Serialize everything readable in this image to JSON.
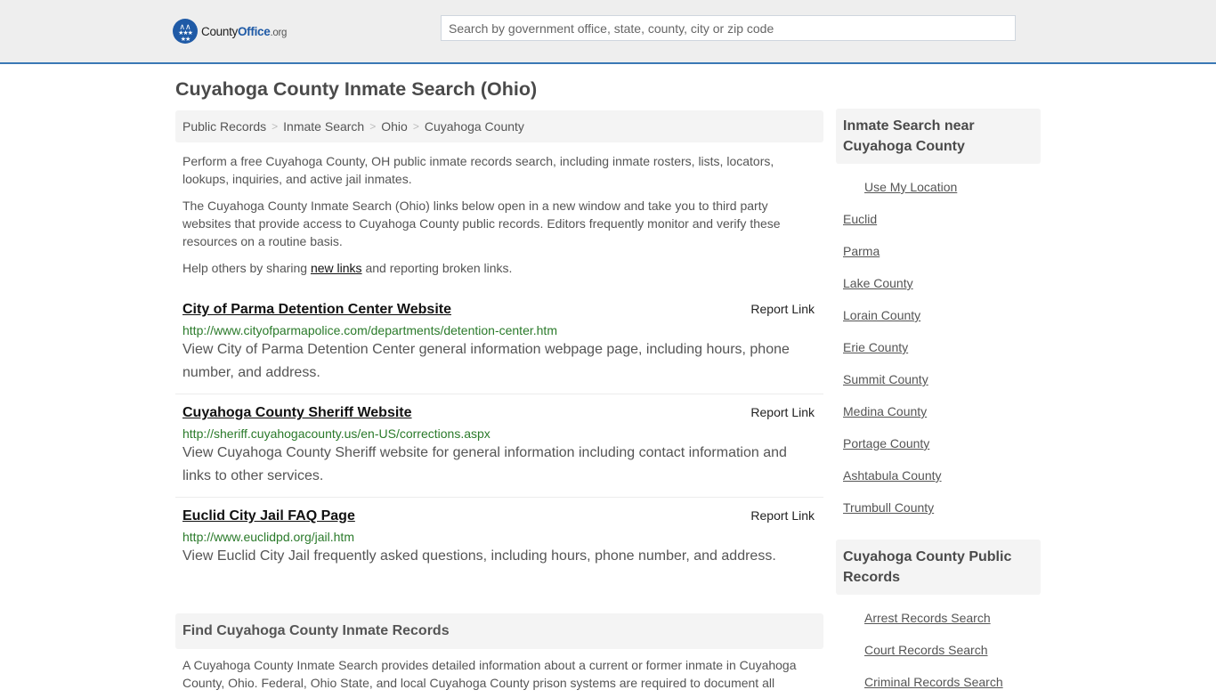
{
  "header": {
    "logo": {
      "name_part1": "County",
      "name_part2": "Office",
      "tld": ".org"
    },
    "search_placeholder": "Search by government office, state, county, city or zip code",
    "accent_color": "#3a78b5"
  },
  "page_title": "Cuyahoga County Inmate Search (Ohio)",
  "breadcrumb": [
    {
      "label": "Public Records"
    },
    {
      "label": "Inmate Search"
    },
    {
      "label": "Ohio"
    },
    {
      "label": "Cuyahoga County"
    }
  ],
  "breadcrumb_separator": ">",
  "intro": {
    "p1": "Perform a free Cuyahoga County, OH public inmate records search, including inmate rosters, lists, locators, lookups, inquiries, and active jail inmates.",
    "p2": "The Cuyahoga County Inmate Search (Ohio) links below open in a new window and take you to third party websites that provide access to Cuyahoga County public records. Editors frequently monitor and verify these resources on a routine basis.",
    "p3_before": "Help others by sharing ",
    "p3_link": "new links",
    "p3_after": " and reporting broken links."
  },
  "links": [
    {
      "title": "City of Parma Detention Center Website",
      "report_label": "Report Link",
      "url": "http://www.cityofparmapolice.com/departments/detention-center.htm",
      "description": "View City of Parma Detention Center general information webpage page, including hours, phone number, and address."
    },
    {
      "title": "Cuyahoga County Sheriff Website",
      "report_label": "Report Link",
      "url": "http://sheriff.cuyahogacounty.us/en-US/corrections.aspx",
      "description": "View Cuyahoga County Sheriff website for general information including contact information and links to other services."
    },
    {
      "title": "Euclid City Jail FAQ Page",
      "report_label": "Report Link",
      "url": "http://www.euclidpd.org/jail.htm",
      "description": "View Euclid City Jail frequently asked questions, including hours, phone number, and address."
    }
  ],
  "find_section": {
    "title": "Find Cuyahoga County Inmate Records",
    "text": "A Cuyahoga County Inmate Search provides detailed information about a current or former inmate in Cuyahoga County, Ohio. Federal, Ohio State, and local Cuyahoga County prison systems are required to document all"
  },
  "sidebar": {
    "nearby_title": "Inmate Search near Cuyahoga County",
    "use_location": "Use My Location",
    "nearby": [
      "Euclid",
      "Parma",
      "Lake County",
      "Lorain County",
      "Erie County",
      "Summit County",
      "Medina County",
      "Portage County",
      "Ashtabula County",
      "Trumbull County"
    ],
    "records_title": "Cuyahoga County Public Records",
    "records": [
      "Arrest Records Search",
      "Court Records Search",
      "Criminal Records Search"
    ]
  }
}
